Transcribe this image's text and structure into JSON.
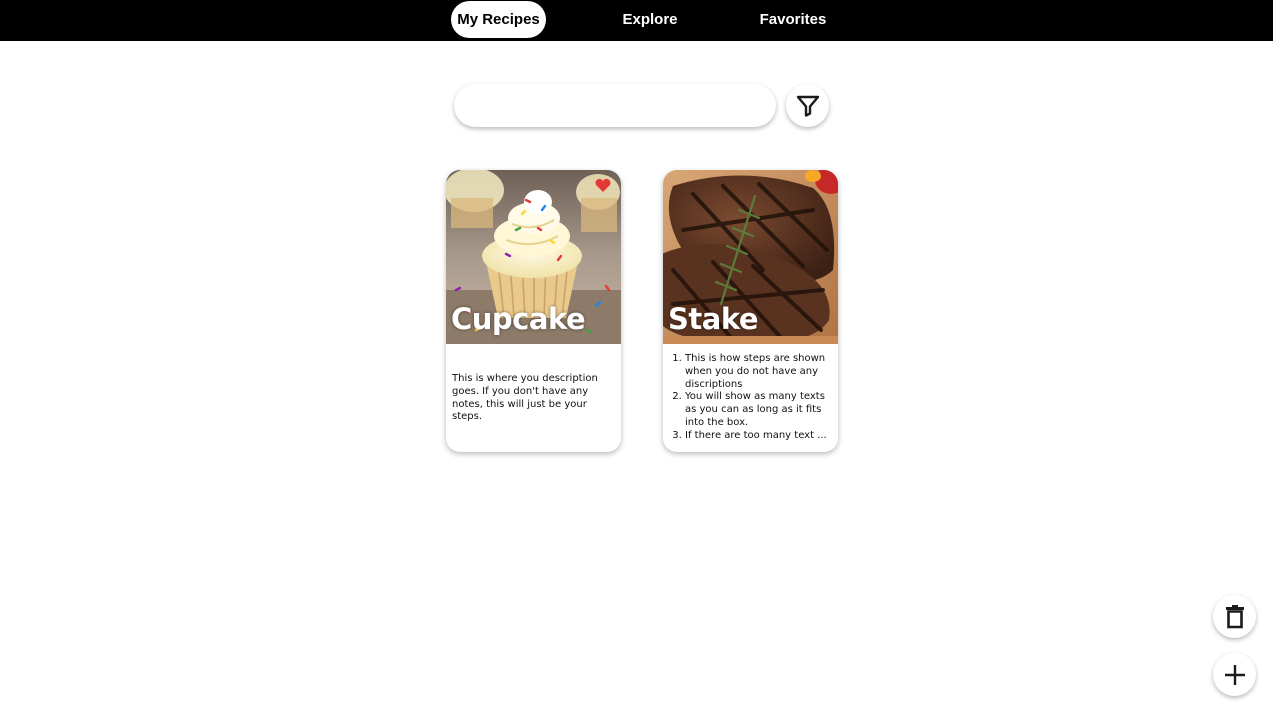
{
  "nav": {
    "tabs": [
      {
        "label": "My Recipes",
        "active": true
      },
      {
        "label": "Explore",
        "active": false
      },
      {
        "label": "Favorites",
        "active": false
      }
    ]
  },
  "search": {
    "placeholder": "",
    "value": ""
  },
  "icons": {
    "filter": "filter-icon",
    "delete": "trash-icon",
    "add": "plus-icon",
    "favorite": "heart-icon"
  },
  "colors": {
    "nav_background": "#000000",
    "favorite_heart": "#e53935"
  },
  "recipes": [
    {
      "title": "Cupcake",
      "favorite": true,
      "description": "This is where you description goes. If you don't have any notes, this will just be your steps."
    },
    {
      "title": "Stake",
      "favorite": false,
      "steps": [
        "This is how steps are shown when you do not have any discriptions",
        "You will show as many texts as you can as long as it fits into the box.",
        "If there are too many text ..."
      ]
    }
  ]
}
